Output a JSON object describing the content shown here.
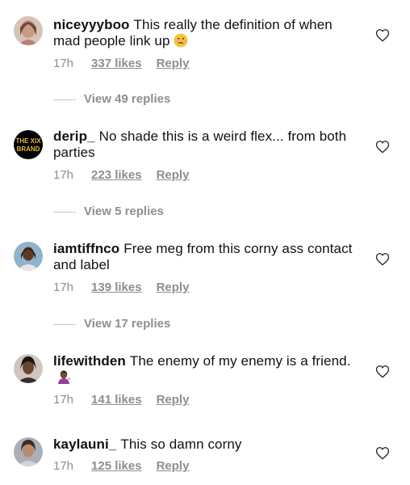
{
  "comments": [
    {
      "username": "niceyyyboo",
      "text": "This really the definition of when mad people link up",
      "emoji": "🥴",
      "time": "17h",
      "likes": "337 likes",
      "reply": "Reply",
      "view_replies": "View 49 replies"
    },
    {
      "username": "derip_",
      "text": "No shade this is a weird flex... from both parties",
      "avatar_text": "THE XIX BRAND",
      "time": "17h",
      "likes": "223 likes",
      "reply": "Reply",
      "view_replies": "View 5 replies"
    },
    {
      "username": "iamtiffnco",
      "text": "Free meg from this corny ass contact and label",
      "time": "17h",
      "likes": "139 likes",
      "reply": "Reply",
      "view_replies": "View 17 replies"
    },
    {
      "username": "lifewithden",
      "text": "The enemy of my enemy is a friend.",
      "emoji": "💁🏾‍♀️",
      "time": "17h",
      "likes": "141 likes",
      "reply": "Reply"
    },
    {
      "username": "kaylauni_",
      "text": "This so damn corny",
      "time": "17h",
      "likes": "125 likes",
      "reply": "Reply"
    }
  ],
  "icons": {
    "heart": "heart-outline-icon",
    "reply_line": "divider-line"
  },
  "colors": {
    "text": "#111111",
    "meta": "#8e8e8e",
    "divider": "#c7c7c7"
  }
}
